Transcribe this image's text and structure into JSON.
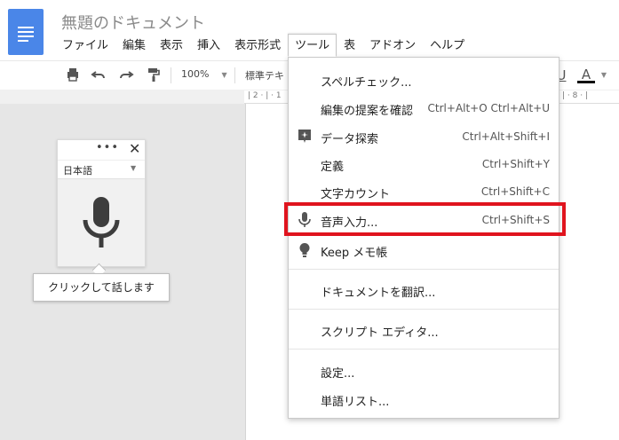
{
  "doc_title": "無題のドキュメント",
  "menubar": [
    "ファイル",
    "編集",
    "表示",
    "挿入",
    "表示形式",
    "ツール",
    "表",
    "アドオン",
    "ヘルプ"
  ],
  "toolbar": {
    "zoom": "100%",
    "style": "標準テキ",
    "ruler_marks": "| 2 · | · 1",
    "ruler_right": "| · 8 · |",
    "underline": "U",
    "text_color": "A"
  },
  "voice": {
    "dots": "•••",
    "close": "✕",
    "language": "日本語",
    "tooltip": "クリックして話します"
  },
  "tools_menu": [
    {
      "label": "スペルチェック...",
      "shortcut": ""
    },
    {
      "label": "編集の提案を確認",
      "shortcut": "Ctrl+Alt+O Ctrl+Alt+U"
    },
    {
      "label": "データ探索",
      "shortcut": "Ctrl+Alt+Shift+I",
      "icon": "explore-icon"
    },
    {
      "label": "定義",
      "shortcut": "Ctrl+Shift+Y"
    },
    {
      "label": "文字カウント",
      "shortcut": "Ctrl+Shift+C"
    },
    {
      "label": "音声入力...",
      "shortcut": "Ctrl+Shift+S",
      "icon": "mic-icon"
    },
    {
      "label": "Keep メモ帳",
      "shortcut": "",
      "icon": "lightbulb-icon"
    },
    {
      "label": "ドキュメントを翻訳...",
      "shortcut": ""
    },
    {
      "label": "スクリプト エディタ...",
      "shortcut": ""
    },
    {
      "label": "設定...",
      "shortcut": ""
    },
    {
      "label": "単語リスト...",
      "shortcut": ""
    }
  ],
  "colors": {
    "accent": "#4a86e8",
    "highlight": "#e0141e"
  }
}
